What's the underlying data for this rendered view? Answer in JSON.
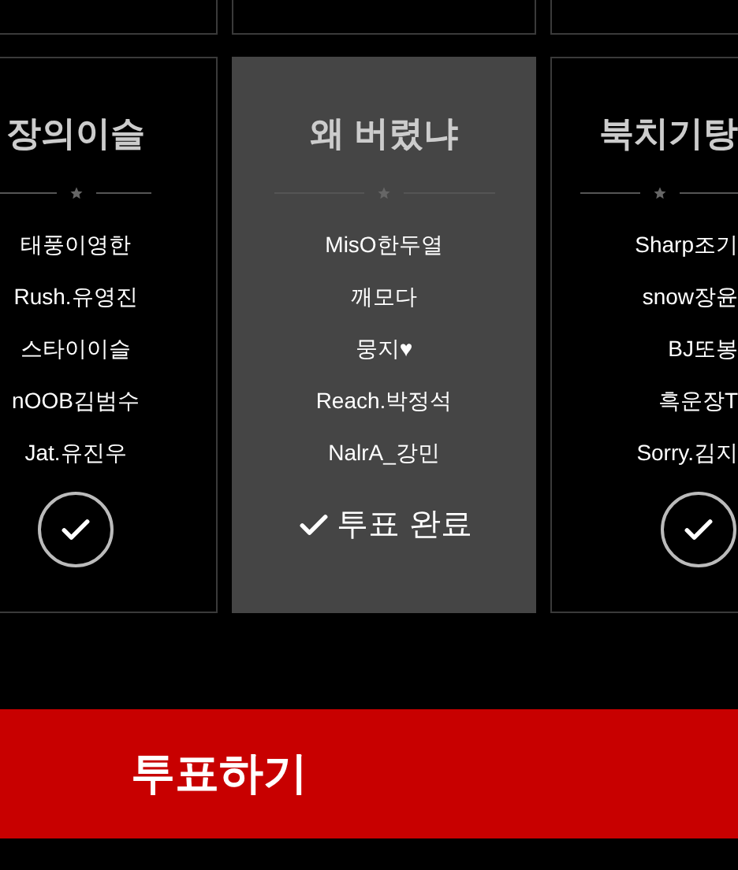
{
  "teams": [
    {
      "title": "장의이슬",
      "members": [
        "태풍이영한",
        "Rush.유영진",
        "스타이이슬",
        "nOOB김범수",
        "Jat.유진우"
      ],
      "selected": false
    },
    {
      "title": "왜 버렸냐",
      "members": [
        "MisO한두열",
        "깨모다",
        "뭉지♥",
        "Reach.박정석",
        "NalrA_강민"
      ],
      "selected": true,
      "voted_label": "투표 완료"
    },
    {
      "title": "북치기탕",
      "members": [
        "Sharp조기",
        "snow장윤",
        "BJ또봉",
        "흑운장T",
        "Sorry.김지"
      ],
      "selected": false
    }
  ],
  "vote_button": {
    "label": "투표하기"
  }
}
